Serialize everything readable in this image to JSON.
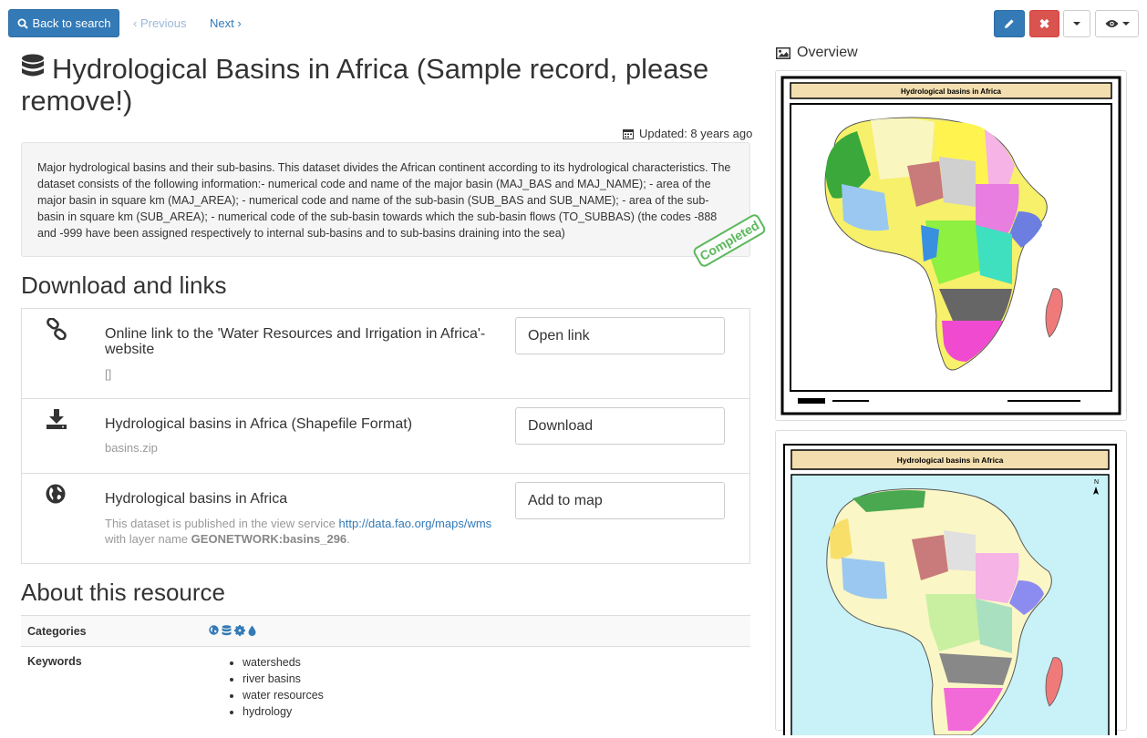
{
  "toolbar": {
    "back_label": "Back to search",
    "previous_label": "‹ Previous",
    "next_label": "Next ›",
    "delete_glyph": "✖"
  },
  "title": "Hydrological Basins in Africa (Sample record, please remove!)",
  "updated": "Updated: 8 years ago",
  "abstract": "Major hydrological basins and their sub-basins. This dataset divides the African continent according to its hydrological characteristics. The dataset consists of the following information:- numerical code and name of the major basin (MAJ_BAS and MAJ_NAME); - area of the major basin in square km (MAJ_AREA); - numerical code and name of the sub-basin (SUB_BAS and SUB_NAME); - area of the sub-basin in square km (SUB_AREA); - numerical code of the sub-basin towards which the sub-basin flows (TO_SUBBAS) (the codes -888 and -999 have been assigned respectively to internal sub-basins and to sub-basins draining into the sea)",
  "status_stamp": "Completed",
  "downloads": {
    "heading": "Download and links",
    "items": [
      {
        "icon": "link-icon",
        "title": "Online link to the 'Water Resources and Irrigation in Africa'- website",
        "sub": "[]",
        "button": "Open link"
      },
      {
        "icon": "download-icon",
        "title": "Hydrological basins in Africa (Shapefile Format)",
        "sub": "basins.zip",
        "button": "Download"
      },
      {
        "icon": "globe-icon",
        "title": "Hydrological basins in Africa",
        "sub_prefix": "This dataset is published in the view service",
        "sub_link": "http://data.fao.org/maps/wms",
        "sub_mid": "with layer name",
        "sub_layer": "GEONETWORK:basins_296",
        "sub_end": ".",
        "button": "Add to map"
      }
    ]
  },
  "about": {
    "heading": "About this resource",
    "categories_label": "Categories",
    "category_icons": [
      "globe-icon",
      "database-icon",
      "gear-icon",
      "drop-icon"
    ],
    "keywords_label": "Keywords",
    "keywords": [
      "watersheds",
      "river basins",
      "water resources",
      "hydrology"
    ]
  },
  "overview": {
    "heading": "Overview",
    "thumb1_title": "Hydrological basins in Africa",
    "thumb2_title": "Hydrological basins in Africa",
    "north_letter": "N"
  },
  "colors": {
    "primary": "#337ab7",
    "danger": "#d9534f",
    "success": "#5cb85c"
  }
}
